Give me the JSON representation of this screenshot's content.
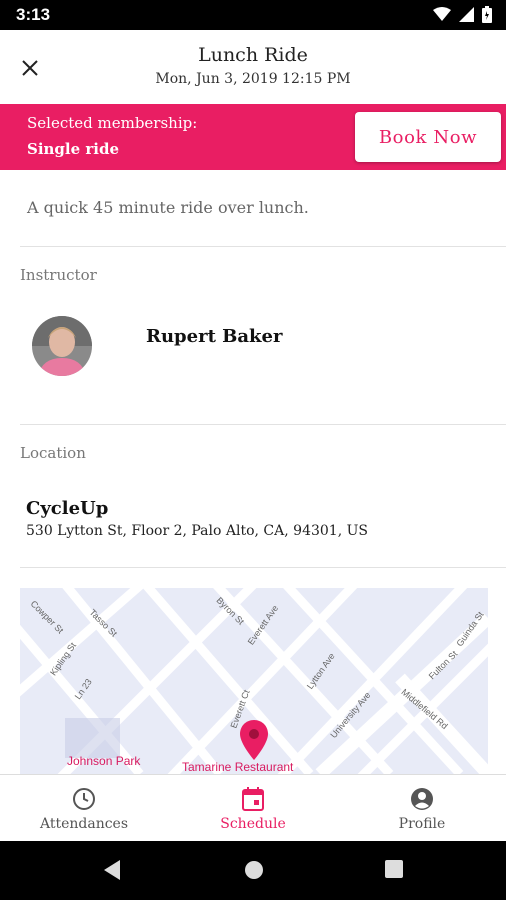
{
  "status_bar": {
    "time": "3:13"
  },
  "header": {
    "title": "Lunch Ride",
    "datetime": "Mon, Jun 3, 2019 12:15 PM"
  },
  "membership": {
    "label": "Selected membership:",
    "value": "Single ride",
    "book_label": "Book Now"
  },
  "description": "A quick 45 minute ride over lunch.",
  "instructor": {
    "section_label": "Instructor",
    "name": "Rupert Baker"
  },
  "location": {
    "section_label": "Location",
    "name": "CycleUp",
    "address": "530 Lytton St, Floor 2, Palo Alto, CA, 94301, US"
  },
  "map": {
    "streets": [
      "Cowper St",
      "Tasso St",
      "Byron St",
      "Everett Ave",
      "Guinda St",
      "Kipling St",
      "Lytton Ave",
      "Fulton St",
      "Ln 23",
      "Everett Ct",
      "University Ave",
      "Middlefield Rd"
    ],
    "pois": [
      "Johnson Park",
      "Tamarine Restaurant"
    ],
    "colors": {
      "background": "#e8ebf7",
      "roads": "#ffffff",
      "pin": "#e91e63"
    }
  },
  "bottom_nav": [
    {
      "label": "Attendances",
      "icon": "clock-icon",
      "active": false
    },
    {
      "label": "Schedule",
      "icon": "calendar-icon",
      "active": true
    },
    {
      "label": "Profile",
      "icon": "account-circle-icon",
      "active": false
    }
  ],
  "colors": {
    "accent": "#e91e63",
    "status_bar": "#000000"
  }
}
